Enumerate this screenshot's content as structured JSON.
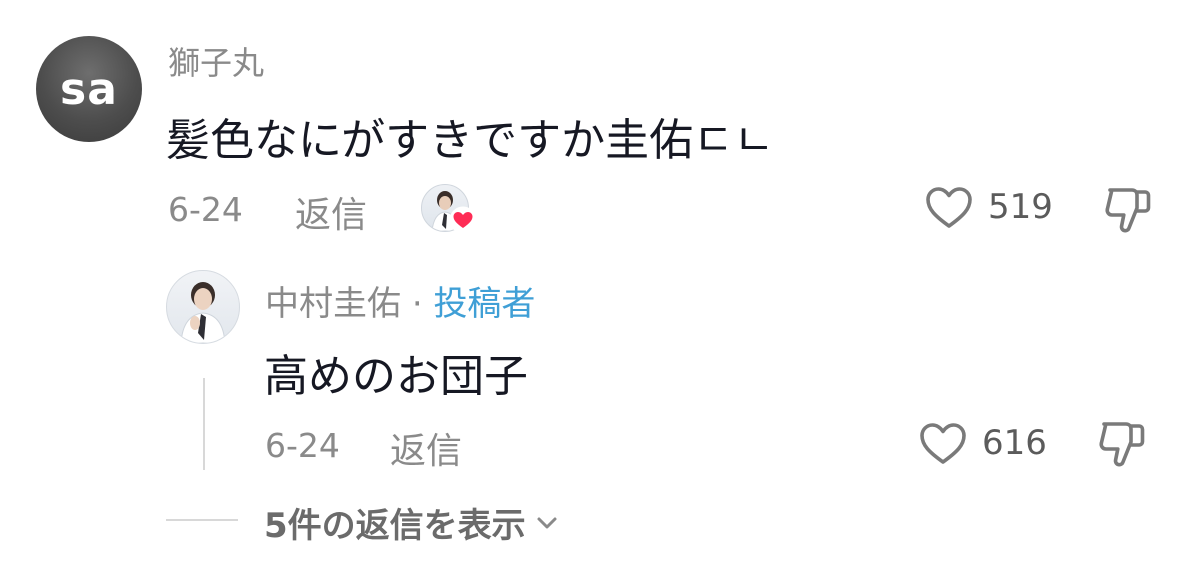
{
  "comment": {
    "avatar_initials": "sa",
    "username": "獅子丸",
    "text": "髪色なにがすきですか圭佑ㄷㄴ",
    "date": "6-24",
    "reply_label": "返信",
    "like_count": "519"
  },
  "reply": {
    "username": "中村圭佑",
    "separator": "·",
    "creator_badge": "投稿者",
    "text": "高めのお団子",
    "date": "6-24",
    "reply_label": "返信",
    "like_count": "616"
  },
  "view_replies_label": "5件の返信を表示",
  "colors": {
    "text_primary": "#161823",
    "text_secondary": "#8a8a8a",
    "creator_badge": "#3f9fd6",
    "heart_badge": "#fe2c55"
  },
  "icons": [
    "heart-outline-icon",
    "thumbs-down-icon",
    "chevron-down-icon",
    "creator-heart-badge-icon"
  ]
}
